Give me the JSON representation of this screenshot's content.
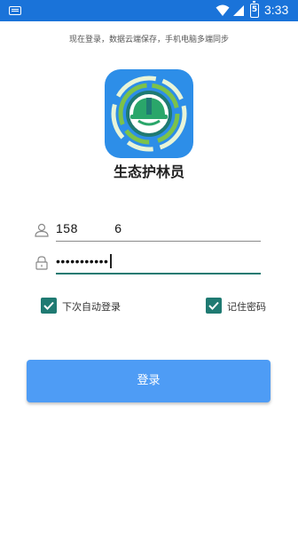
{
  "status_bar": {
    "time": "3:33",
    "battery_level": "5",
    "icons": [
      "keyboard-icon",
      "wifi-icon",
      "signal-icon",
      "battery-icon"
    ]
  },
  "header": {
    "subtitle": "现在登录，数据云端保存，手机电脑多端同步"
  },
  "app": {
    "name": "生态护林员",
    "logo_icon": "forest-ranger-helmet-icon"
  },
  "form": {
    "username_value": "158     6",
    "password_value": "•••••••••••",
    "user_icon": "user-icon",
    "lock_icon": "lock-icon"
  },
  "options": {
    "auto_login_label": "下次自动登录",
    "auto_login_checked": true,
    "remember_password_label": "记住密码",
    "remember_password_checked": true
  },
  "actions": {
    "login_label": "登录"
  },
  "colors": {
    "status_bar": "#1a73d9",
    "accent": "#1f7a72",
    "button": "#4e9cf5",
    "logo_bg": "#2d8ee8"
  }
}
